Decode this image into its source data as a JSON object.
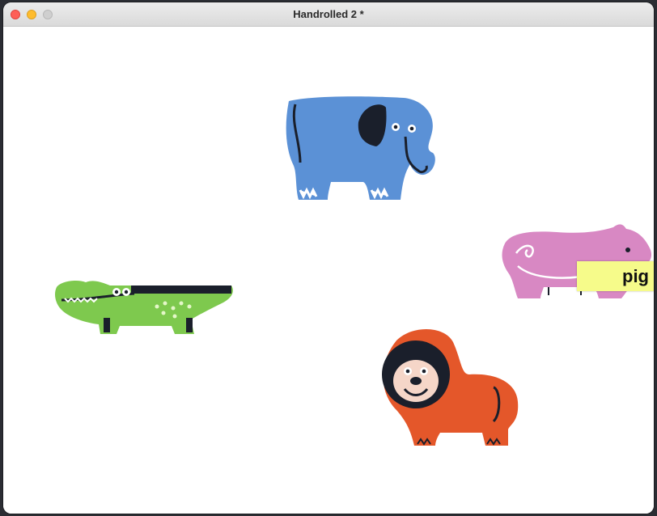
{
  "window": {
    "title": "Handrolled 2 *"
  },
  "animals": [
    {
      "name": "elephant",
      "color": "#5b91d6"
    },
    {
      "name": "pig",
      "color": "#d888c3"
    },
    {
      "name": "crocodile",
      "color": "#7ec94e"
    },
    {
      "name": "lion",
      "color": "#e4572a"
    }
  ],
  "label": {
    "text": "pig",
    "color": "#f6fb8a"
  }
}
